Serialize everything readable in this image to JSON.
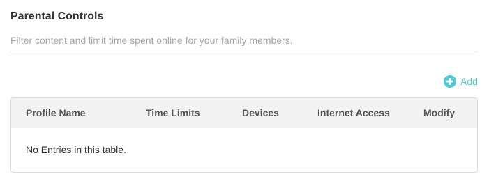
{
  "header": {
    "title": "Parental Controls",
    "subtitle": "Filter content and limit time spent online for your family members."
  },
  "toolbar": {
    "add_label": "Add",
    "add_icon": "plus-circle-icon",
    "accent_color": "#4acbd6"
  },
  "table": {
    "columns": [
      "Profile Name",
      "Time Limits",
      "Devices",
      "Internet Access",
      "Modify"
    ],
    "rows": [],
    "empty_text": "No Entries in this table."
  }
}
